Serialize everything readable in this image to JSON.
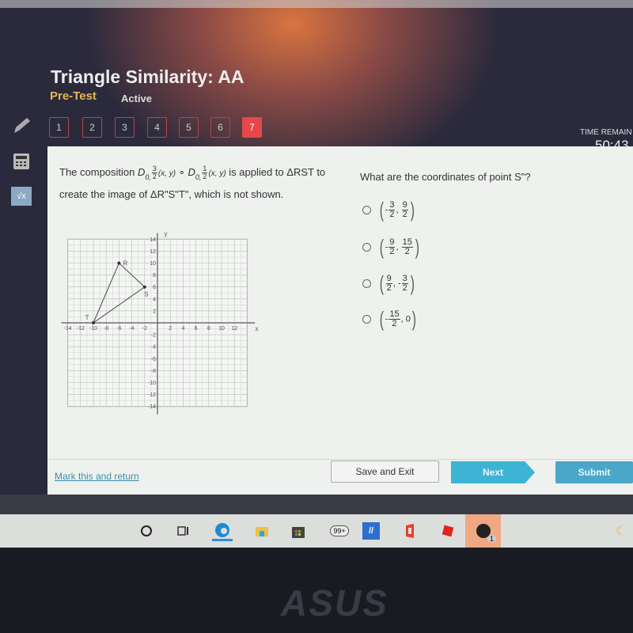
{
  "header": {
    "title": "Triangle Similarity: AA",
    "subtitle": "Pre-Test",
    "status": "Active",
    "question_numbers": [
      "1",
      "2",
      "3",
      "4",
      "5",
      "6",
      "7"
    ],
    "current_question": "7",
    "timer_label": "TIME REMAIN",
    "timer": "50:43"
  },
  "tools": [
    {
      "icon": "pencil-icon"
    },
    {
      "icon": "calculator-icon"
    },
    {
      "icon": "square-root-icon",
      "label": "√x"
    }
  ],
  "question": {
    "prefix": "The composition ",
    "op1": {
      "letter": "D",
      "center": "0,",
      "num": "3",
      "den": "2",
      "args": "(x, y)"
    },
    "compose": " ∘ ",
    "op2": {
      "letter": "D",
      "center": "0,",
      "num": "1",
      "den": "2",
      "args": "(x, y)"
    },
    "suffix": " is applied to ΔRST to create the image of ΔR\"S\"T\", which is not shown.",
    "prompt": "What are the coordinates of point S\"?"
  },
  "options": [
    {
      "x": {
        "sign": "-",
        "num": "3",
        "den": "2"
      },
      "y": {
        "sign": "",
        "num": "9",
        "den": "2"
      }
    },
    {
      "x": {
        "sign": "-",
        "num": "9",
        "den": "2"
      },
      "y": {
        "sign": "",
        "num": "15",
        "den": "2"
      }
    },
    {
      "x": {
        "sign": "",
        "num": "9",
        "den": "2"
      },
      "y": {
        "sign": "-",
        "num": "3",
        "den": "2"
      }
    },
    {
      "x": {
        "sign": "-",
        "num": "15",
        "den": "2"
      },
      "y": {
        "value": "0"
      }
    }
  ],
  "chart_data": {
    "type": "scatter",
    "xlabel": "x",
    "ylabel": "y",
    "xlim": [
      -14,
      14
    ],
    "ylim": [
      -14,
      14
    ],
    "grid": true,
    "x_ticks": [
      "-14",
      "-12",
      "-10",
      "-8",
      "-6",
      "-4",
      "-2",
      "2",
      "4",
      "6",
      "8",
      "10",
      "12"
    ],
    "y_ticks": [
      "14",
      "12",
      "10",
      "8",
      "6",
      "4",
      "2",
      "-2",
      "-4",
      "-6",
      "-8",
      "-10",
      "-12",
      "-14"
    ],
    "points": [
      {
        "label": "R",
        "x": -6,
        "y": 10
      },
      {
        "label": "S",
        "x": -2,
        "y": 6
      },
      {
        "label": "T",
        "x": -10,
        "y": 0
      }
    ],
    "polygon": [
      "R",
      "S",
      "T"
    ]
  },
  "footer": {
    "mark": "Mark this and return",
    "save": "Save and Exit",
    "next": "Next",
    "submit": "Submit"
  },
  "taskbar": {
    "mail_badge": "99+",
    "xbox_badge": "1"
  },
  "bezel_logo": "ASUS",
  "colors": {
    "accent": "#3eb4d4",
    "current_question": "#e5474a",
    "pretest": "#e5b653",
    "link": "#3a8fa8"
  }
}
